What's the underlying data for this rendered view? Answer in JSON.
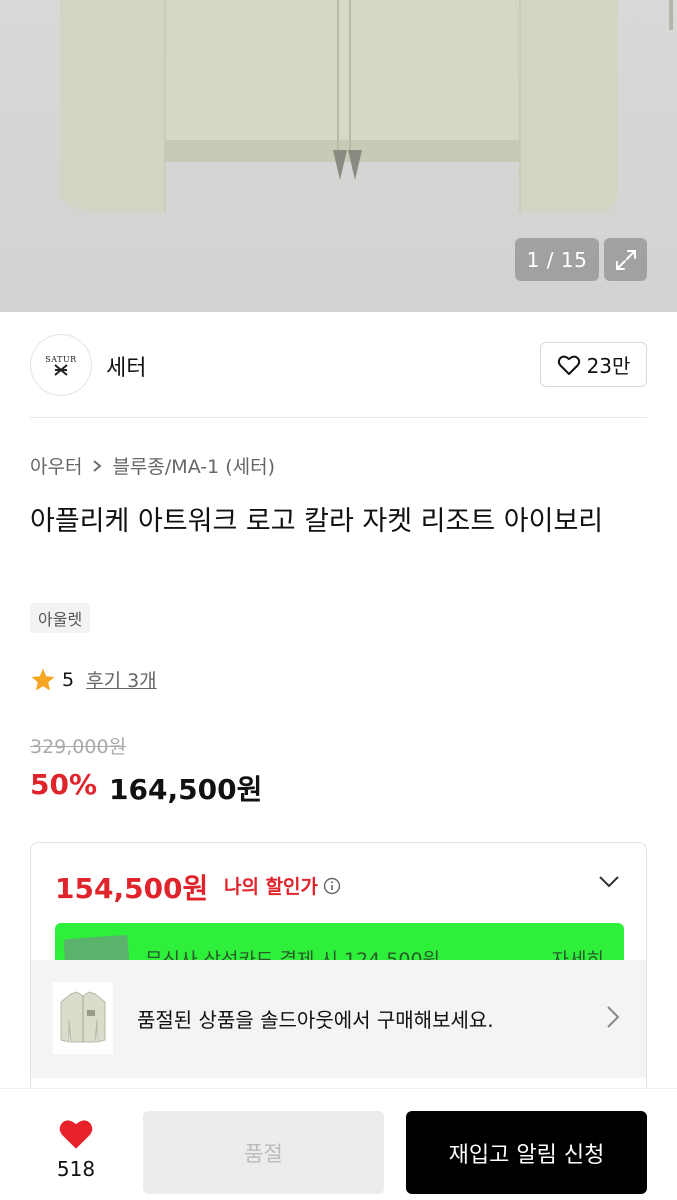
{
  "gallery": {
    "counter": "1 / 15",
    "icon": "expand-icon"
  },
  "brand": {
    "logo_text": "SATUR",
    "name": "세터",
    "like_count": "23만",
    "like_icon": "heart-outline-icon"
  },
  "breadcrumb": {
    "category": "아우터",
    "subcategory": "블루종/MA-1 (세터)"
  },
  "product": {
    "title": "아플리케 아트워크 로고 칼라 자켓 리조트 아이보리",
    "tag": "아울렛",
    "rating": "5",
    "review_link": "후기 3개",
    "original_price": "329,000원",
    "discount_percent": "50%",
    "sale_price": "164,500원"
  },
  "my_discount": {
    "price": "154,500원",
    "label": "나의 할인가",
    "card_text": "무신사 삼성카드 결제 시 124,500원",
    "card_more": "자세히"
  },
  "soldout_banner": {
    "text": "품절된 상품을 솔드아웃에서 구매해보세요."
  },
  "bottom_bar": {
    "wish_count": "518",
    "soldout_label": "품절",
    "restock_label": "재입고 알림 신청"
  },
  "colors": {
    "accent_red": "#e0242c",
    "card_green": "#2ef03b",
    "button_black": "#000000"
  }
}
